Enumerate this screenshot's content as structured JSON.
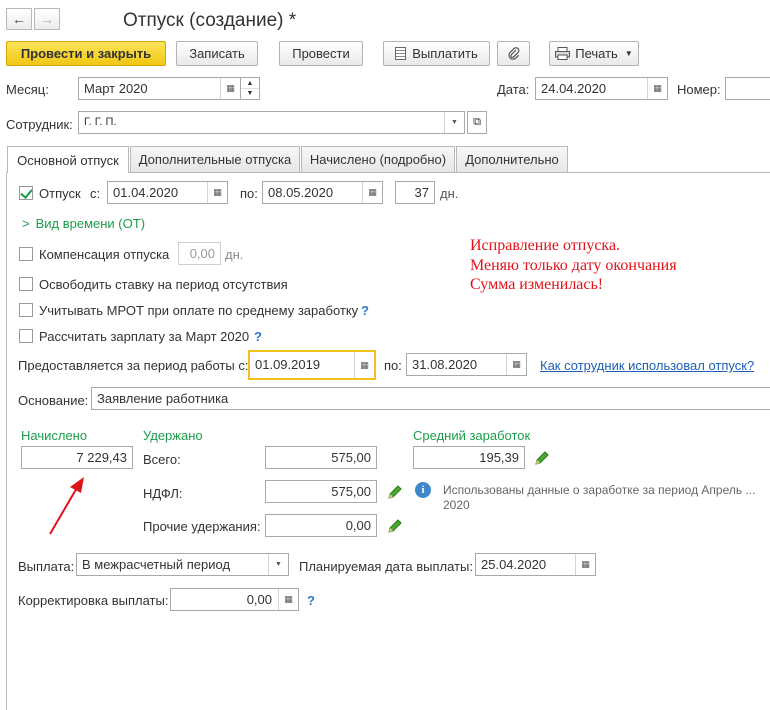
{
  "window": {
    "title": "Отпуск (создание) *"
  },
  "nav": {
    "back_icon": "←",
    "forward_icon": "→"
  },
  "toolbar": {
    "post_close": "Провести и закрыть",
    "save": "Записать",
    "post": "Провести",
    "pay": "Выплатить",
    "print": "Печать"
  },
  "header": {
    "month_label": "Месяц:",
    "month_value": "Март 2020",
    "date_label": "Дата:",
    "date_value": "24.04.2020",
    "number_label": "Номер:",
    "number_value": "",
    "employee_label": "Сотрудник:",
    "employee_value": "Г.                          Г.             П."
  },
  "tabs": [
    {
      "label": "Основной отпуск"
    },
    {
      "label": "Дополнительные отпуска"
    },
    {
      "label": "Начислено (подробно)"
    },
    {
      "label": "Дополнительно"
    }
  ],
  "vacation": {
    "label": "Отпуск",
    "from_label": "с:",
    "from_value": "01.04.2020",
    "to_label": "по:",
    "to_value": "08.05.2020",
    "days_value": "37",
    "days_unit": "дн."
  },
  "time_type": {
    "label": "Вид времени (ОТ)"
  },
  "compensation": {
    "label": "Компенсация отпуска",
    "value": "0,00",
    "unit": "дн."
  },
  "options": {
    "free_rate": "Освободить ставку на период отсутствия",
    "mrot": "Учитывать МРОТ при оплате по среднему заработку",
    "calc_salary": "Рассчитать зарплату за Март 2020",
    "help": "?"
  },
  "period": {
    "label": "Предоставляется за период работы с:",
    "from_value": "01.09.2019",
    "to_label": "по:",
    "to_value": "31.08.2020",
    "link": "Как сотрудник использовал отпуск?"
  },
  "basis": {
    "label": "Основание:",
    "value": "Заявление работника"
  },
  "accrued": {
    "label": "Начислено",
    "value": "7 229,43"
  },
  "withheld": {
    "label": "Удержано",
    "total_label": "Всего:",
    "total_value": "575,00",
    "ndfl_label": "НДФЛ:",
    "ndfl_value": "575,00",
    "other_label": "Прочие удержания:",
    "other_value": "0,00"
  },
  "avg": {
    "label": "Средний заработок",
    "value": "195,39"
  },
  "info": {
    "line1": "Использованы данные о заработке за период Апрель ...",
    "line2": "2020"
  },
  "payment": {
    "label": "Выплата:",
    "value": "В межрасчетный период",
    "planned_label": "Планируемая дата выплаты:",
    "planned_value": "25.04.2020"
  },
  "correction": {
    "label": "Корректировка выплаты:",
    "value": "0,00",
    "help": "?"
  },
  "annotation": {
    "line1": "Исправление отпуска.",
    "line2": "Меняю только дату окончания",
    "line3": "Сумма изменилась!"
  },
  "colors": {
    "accent_green": "#1b9d4a",
    "primary_button": "#f2c711",
    "annotation_red": "#e0131a",
    "link_blue": "#1e5fb4"
  }
}
